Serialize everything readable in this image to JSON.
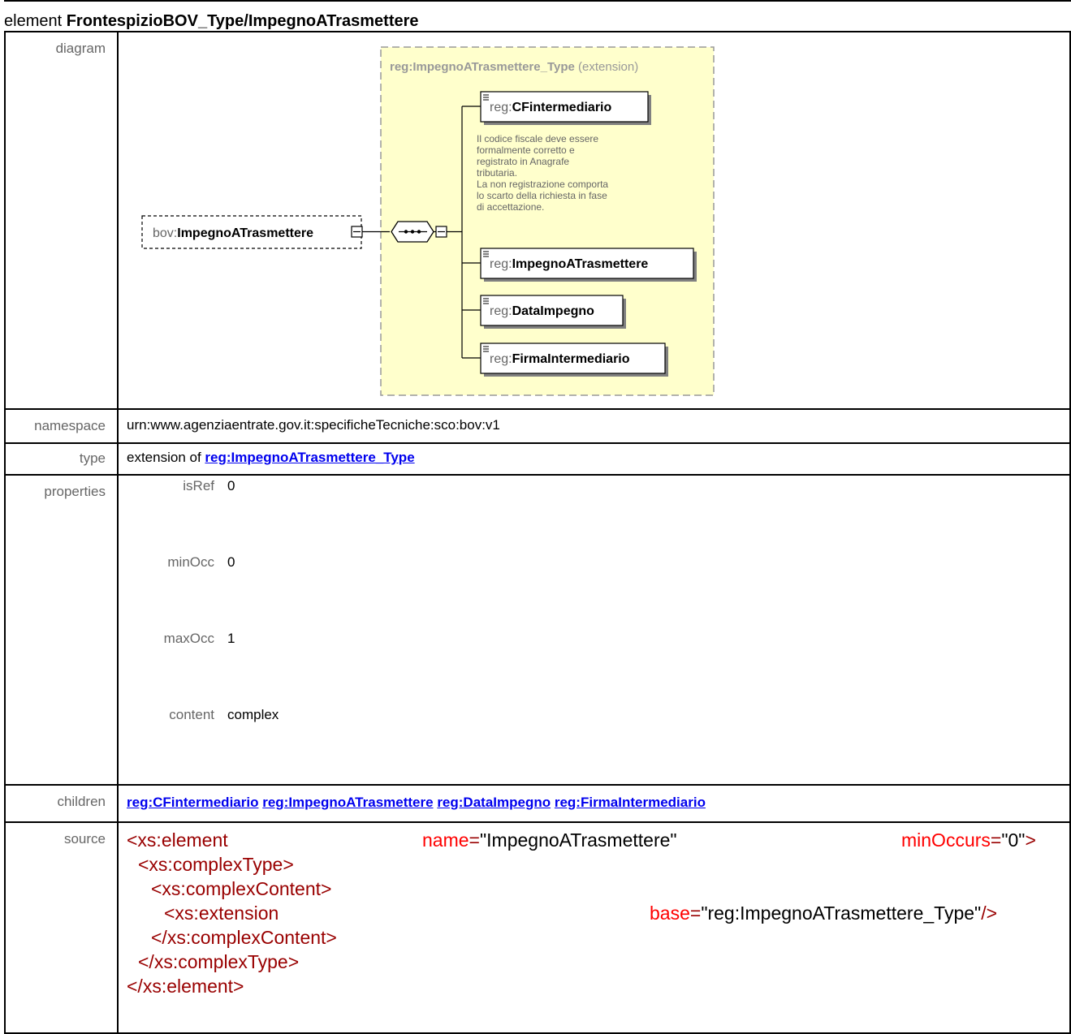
{
  "heading": {
    "prefix": "element",
    "name": "FrontespizioBOV_Type/ImpegnoATrasmettere"
  },
  "labels": {
    "diagram": "diagram",
    "namespace": "namespace",
    "type": "type",
    "properties": "properties",
    "children": "children",
    "source": "source"
  },
  "diagram": {
    "element": {
      "prefix": "bov:",
      "name": "ImpegnoATrasmettere"
    },
    "complex_type": {
      "name": "reg:ImpegnoATrasmettere_Type",
      "suffix": "(extension)"
    },
    "children": [
      {
        "prefix": "reg:",
        "name": "CFintermediario"
      },
      {
        "prefix": "reg:",
        "name": "ImpegnoATrasmettere"
      },
      {
        "prefix": "reg:",
        "name": "DataImpegno"
      },
      {
        "prefix": "reg:",
        "name": "FirmaIntermediario"
      }
    ],
    "annotation": [
      "Il codice fiscale deve essere",
      "formalmente corretto e",
      "registrato in Anagrafe",
      "tributaria.",
      "La non registrazione comporta",
      "lo scarto della richiesta in fase",
      "di accettazione."
    ],
    "colors": {
      "type_box_fill": "#ffffcc",
      "type_box_border": "#999999",
      "type_label": "#999999"
    }
  },
  "namespace": "urn:www.agenziaentrate.gov.it:specificheTecniche:sco:bov:v1",
  "type": {
    "prefix": "extension of",
    "link": "reg:ImpegnoATrasmettere_Type"
  },
  "properties": [
    {
      "key": "isRef",
      "value": "0"
    },
    {
      "key": "minOcc",
      "value": "0"
    },
    {
      "key": "maxOcc",
      "value": "1"
    },
    {
      "key": "content",
      "value": "complex"
    }
  ],
  "children": [
    "reg:CFintermediario",
    "reg:ImpegnoATrasmettere",
    "reg:DataImpegno",
    "reg:FirmaIntermediario"
  ],
  "source": {
    "l1_open": "<xs:element",
    "l1_attr1": "name",
    "l1_val1": "\"ImpegnoATrasmettere\"",
    "l1_attr2": "minOccurs",
    "l1_val2": "\"0\"",
    "l1_close": ">",
    "l2": "<xs:complexType>",
    "l3": "<xs:complexContent>",
    "l4_open": "<xs:extension",
    "l4_attr": "base",
    "l4_val": "\"reg:ImpegnoATrasmettere_Type\"",
    "l4_close": "/>",
    "l5": "</xs:complexContent>",
    "l6": "</xs:complexType>",
    "l7": "</xs:element>",
    "eq": "="
  }
}
